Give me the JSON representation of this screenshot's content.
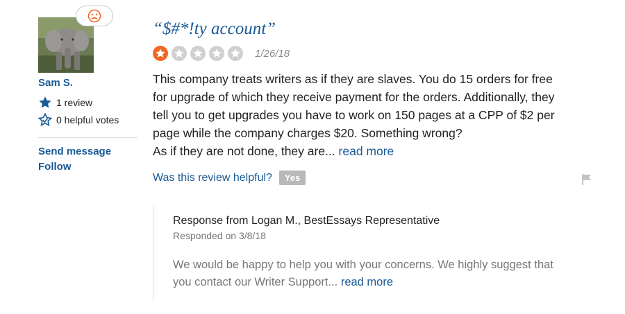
{
  "reviewer": {
    "name": "Sam S.",
    "reviews": "1 review",
    "helpful_votes": "0 helpful votes",
    "send_message": "Send message",
    "follow": "Follow",
    "mood_icon": "sad-face-icon"
  },
  "review": {
    "title": "“$#*!ty account”",
    "rating": 1,
    "max_rating": 5,
    "date": "1/26/18",
    "body_lines": [
      "This company treats writers as if they are slaves. You do 15 orders for free",
      "for upgrade of which they receive payment for the orders. Additionally, they",
      "tell you to get upgrades you have to work on 150 pages at a CPP of $2 per",
      "page while the company charges $20. Something wrong?",
      "As if they are not done, they are..."
    ],
    "read_more": "read more",
    "helpful_question": "Was this review helpful?",
    "yes_label": "Yes"
  },
  "response": {
    "header": "Response from Logan M., BestEssays Representative",
    "date": "Responded on 3/8/18",
    "body_lines": [
      "We would be happy to help you with your concerns. We highly suggest that",
      "you contact our Writer Support..."
    ],
    "read_more": "read more"
  },
  "colors": {
    "link": "#1a5a96",
    "star_active": "#f26722",
    "star_inactive": "#d0d0d0",
    "mood": "#f26722"
  }
}
